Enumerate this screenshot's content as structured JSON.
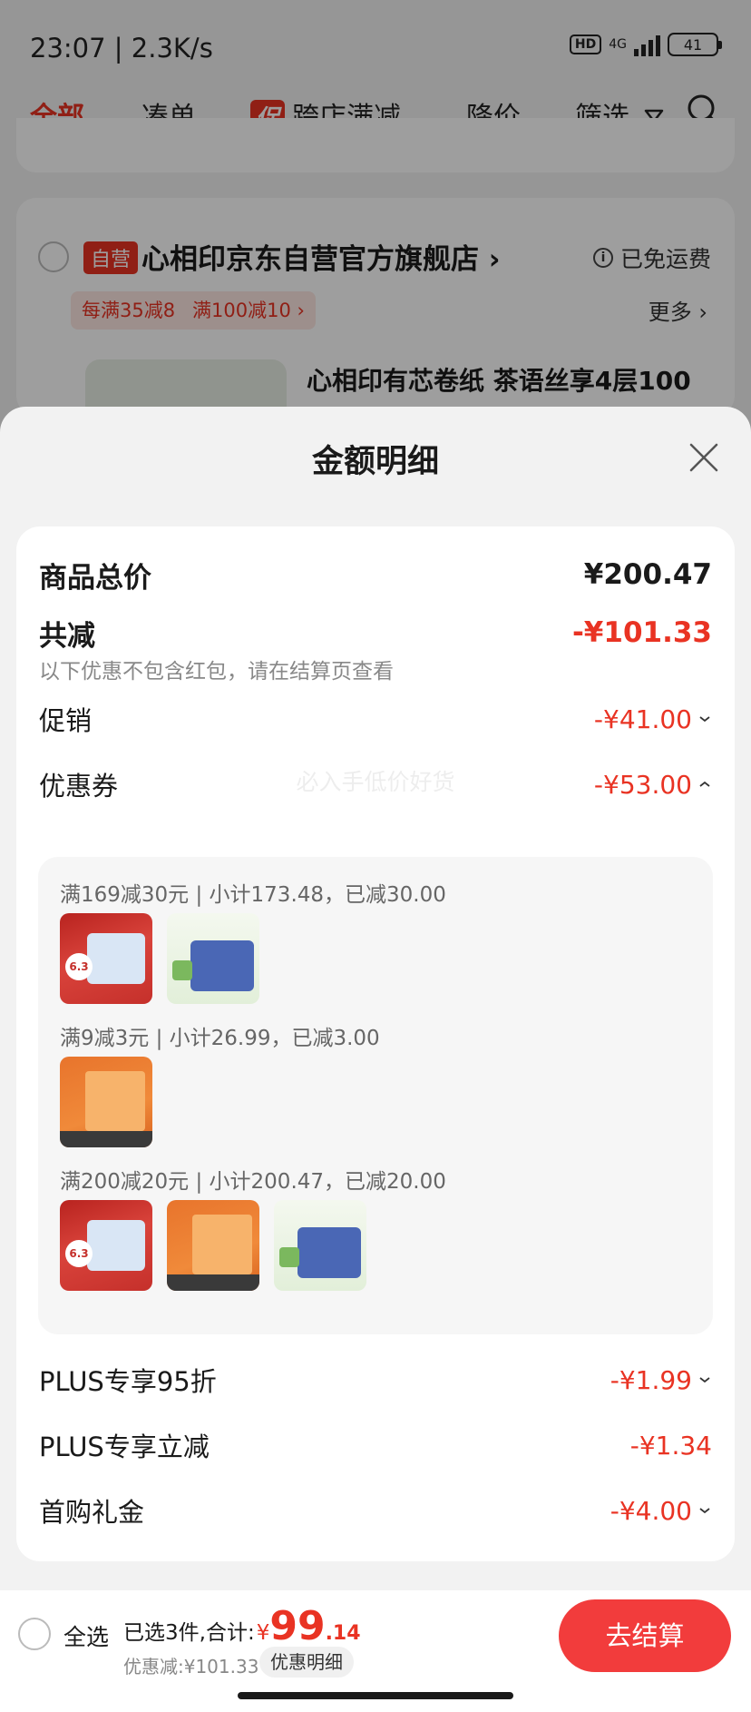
{
  "status_bar": {
    "time": "23:07 | 2.3K/s",
    "hd": "HD",
    "network": "4G",
    "battery": "41"
  },
  "tabs": [
    {
      "label": "全部"
    },
    {
      "label": "凑单"
    },
    {
      "label": "跨店满减",
      "badge": "促"
    },
    {
      "label": "降价"
    },
    {
      "label": "筛选"
    }
  ],
  "store": {
    "self_tag": "自营",
    "name": "心相印京东自营官方旗舰店 ›",
    "shipping": "已免运费",
    "promos": [
      "每满35减8 ›",
      "满100减10 ›"
    ],
    "more": "更多 ›",
    "product_title": "心相印有芯卷纸 茶语丝享4层100"
  },
  "sheet": {
    "title": "金额明细",
    "watermark": "必入手低价好货",
    "total_label": "商品总价",
    "total_value": "¥200.47",
    "reduce_label": "共减",
    "reduce_value": "-¥101.33",
    "reduce_note": "以下优惠不包含红包，请在结算页查看",
    "promo_label": "促销",
    "promo_value": "-¥41.00",
    "coupon_label": "优惠券",
    "coupon_value": "-¥53.00",
    "coupons": [
      {
        "text": "满169减30元 | 小计173.48，已减30.00"
      },
      {
        "text": "满9减3元 | 小计26.99，已减3.00"
      },
      {
        "text": "满200减20元 | 小计200.47，已减20.00"
      }
    ],
    "plus95_label": "PLUS专享95折",
    "plus95_value": "-¥1.99",
    "plus_instant_label": "PLUS专享立减",
    "plus_instant_value": "-¥1.34",
    "first_gift_label": "首购礼金",
    "first_gift_value": "-¥4.00"
  },
  "checkout": {
    "select_all": "全选",
    "selected_text": "已选3件,合计:",
    "yen": "¥",
    "price_int": "99",
    "price_dec": ".14",
    "discount": "优惠减:¥101.33",
    "detail_chip": "优惠明细",
    "button": "去结算"
  },
  "colors": {
    "accent": "#e93323",
    "checkout_button": "#f23c3c"
  }
}
